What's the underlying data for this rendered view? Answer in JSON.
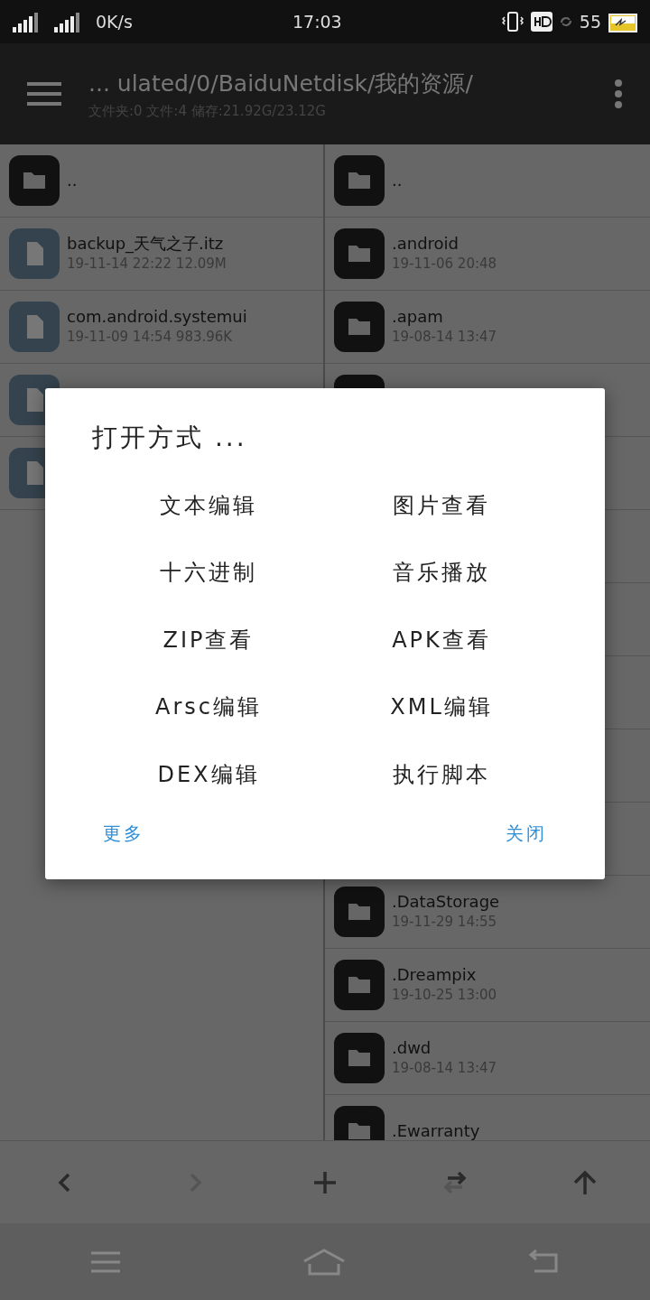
{
  "status_bar": {
    "speed": "0K/s",
    "time": "17:03",
    "battery": "55"
  },
  "header": {
    "path": "... ulated/0/BaiduNetdisk/我的资源/",
    "info": "文件夹:0 文件:4 储存:21.92G/23.12G"
  },
  "left_pane": [
    {
      "kind": "folder",
      "name": ".."
    },
    {
      "kind": "file",
      "name": "backup_天气之子.itz",
      "meta": "19-11-14 22:22  12.09M"
    },
    {
      "kind": "file",
      "name": "com.android.systemui",
      "meta": "19-11-09 14:54  983.96K"
    },
    {
      "kind": "file"
    },
    {
      "kind": "file"
    }
  ],
  "right_pane": [
    {
      "kind": "folder",
      "name": ".."
    },
    {
      "kind": "folder",
      "name": ".android",
      "meta": "19-11-06 20:48"
    },
    {
      "kind": "folder",
      "name": ".apam",
      "meta": "19-08-14 13:47"
    },
    {
      "kind": "folder"
    },
    {
      "kind": "covered"
    },
    {
      "kind": "covered"
    },
    {
      "kind": "covered"
    },
    {
      "kind": "covered"
    },
    {
      "kind": "covered"
    },
    {
      "kind": "covered"
    },
    {
      "kind": "folder",
      "name": ".DataStorage",
      "meta": "19-11-29 14:55"
    },
    {
      "kind": "folder",
      "name": ".Dreampix",
      "meta": "19-10-25 13:00"
    },
    {
      "kind": "folder",
      "name": ".dwd",
      "meta": "19-08-14 13:47"
    },
    {
      "kind": "folder",
      "name": ".Ewarranty"
    }
  ],
  "dialog": {
    "title": "打开方式 ...",
    "options": [
      "文本编辑",
      "图片查看",
      "十六进制",
      "音乐播放",
      "ZIP查看",
      "APK查看",
      "Arsc编辑",
      "XML编辑",
      "DEX编辑",
      "执行脚本"
    ],
    "buttons": [
      "更多",
      "关闭"
    ]
  },
  "toolbar": [
    {
      "kind": "back",
      "disabled": false
    },
    {
      "kind": "forward",
      "disabled": true
    },
    {
      "kind": "add",
      "disabled": false
    },
    {
      "kind": "swap",
      "disabled": false
    },
    {
      "kind": "up",
      "disabled": false
    }
  ]
}
